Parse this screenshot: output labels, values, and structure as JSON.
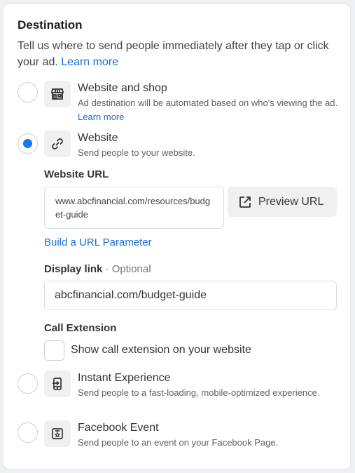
{
  "section": {
    "title": "Destination",
    "description": "Tell us where to send people immediately after they tap or click your ad.",
    "learn_more": "Learn more"
  },
  "options": [
    {
      "title": "Website and shop",
      "description": "Ad destination will be automated based on who's viewing the ad.",
      "learn_more": "Learn more",
      "icon": "storefront-icon",
      "selected": false
    },
    {
      "title": "Website",
      "description": "Send people to your website.",
      "icon": "link-icon",
      "selected": true
    },
    {
      "title": "Instant Experience",
      "description": "Send people to a fast-loading, mobile-optimized experience.",
      "icon": "mobile-arrow-icon",
      "selected": false
    },
    {
      "title": "Facebook Event",
      "description": "Send people to an event on your Facebook Page.",
      "icon": "event-star-icon",
      "selected": false
    }
  ],
  "website_url": {
    "label": "Website URL",
    "value": "www.abcfinancial.com/resources/budget-guide",
    "preview_label": "Preview URL",
    "build_param": "Build a URL Parameter"
  },
  "display_link": {
    "label": "Display link",
    "optional": "· Optional",
    "value": "abcfinancial.com/budget-guide"
  },
  "call_extension": {
    "label": "Call Extension",
    "checkbox_label": "Show call extension on your website",
    "checked": false
  },
  "colors": {
    "accent": "#1877f2",
    "link": "#1a6ed8"
  }
}
